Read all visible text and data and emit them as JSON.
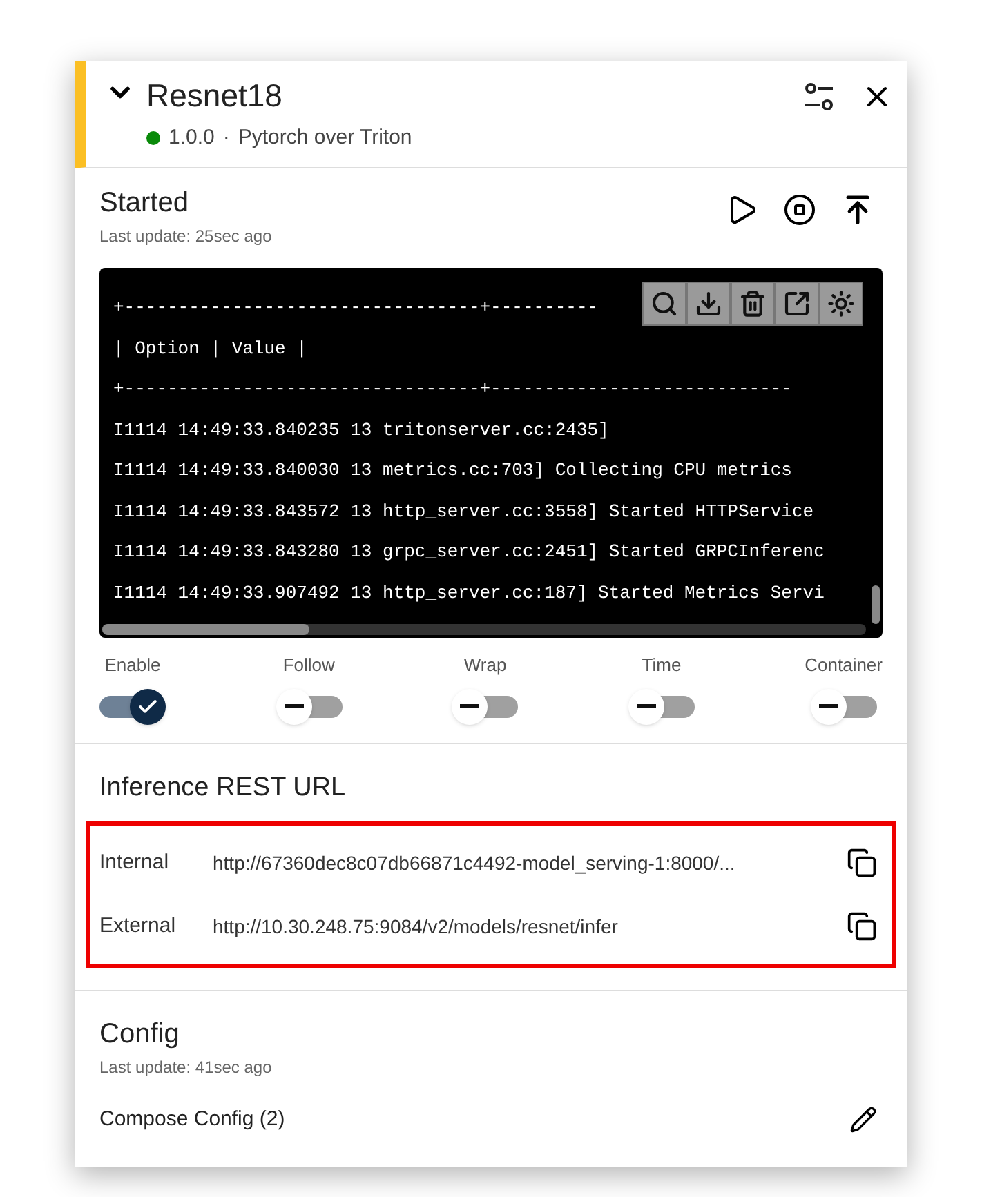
{
  "header": {
    "title": "Resnet18",
    "running": true,
    "version": "1.0.0",
    "separator": "·",
    "framework": "Pytorch over Triton"
  },
  "status": {
    "title": "Started",
    "updated": "Last update: 25sec ago"
  },
  "log": {
    "lines": [
      "+---------------------------------+----------",
      "| Option | Value |",
      "+---------------------------------+----------------------------",
      "I1114 14:49:33.840235 13 tritonserver.cc:2435]",
      "I1114 14:49:33.840030 13 metrics.cc:703] Collecting CPU metrics",
      "I1114 14:49:33.843572 13 http_server.cc:3558] Started HTTPService",
      "I1114 14:49:33.843280 13 grpc_server.cc:2451] Started GRPCInferenc",
      "I1114 14:49:33.907492 13 http_server.cc:187] Started Metrics Servi"
    ]
  },
  "toggles": [
    {
      "label": "Enable",
      "on": true
    },
    {
      "label": "Follow",
      "on": false
    },
    {
      "label": "Wrap",
      "on": false
    },
    {
      "label": "Time",
      "on": false
    },
    {
      "label": "Container",
      "on": false
    }
  ],
  "inference": {
    "title": "Inference REST URL",
    "urls": [
      {
        "label": "Internal",
        "value": "http://67360dec8c07db66871c4492-model_serving-1:8000/..."
      },
      {
        "label": "External",
        "value": "http://10.30.248.75:9084/v2/models/resnet/infer"
      }
    ]
  },
  "config": {
    "title": "Config",
    "updated": "Last update: 41sec ago",
    "item": "Compose Config (2)"
  }
}
